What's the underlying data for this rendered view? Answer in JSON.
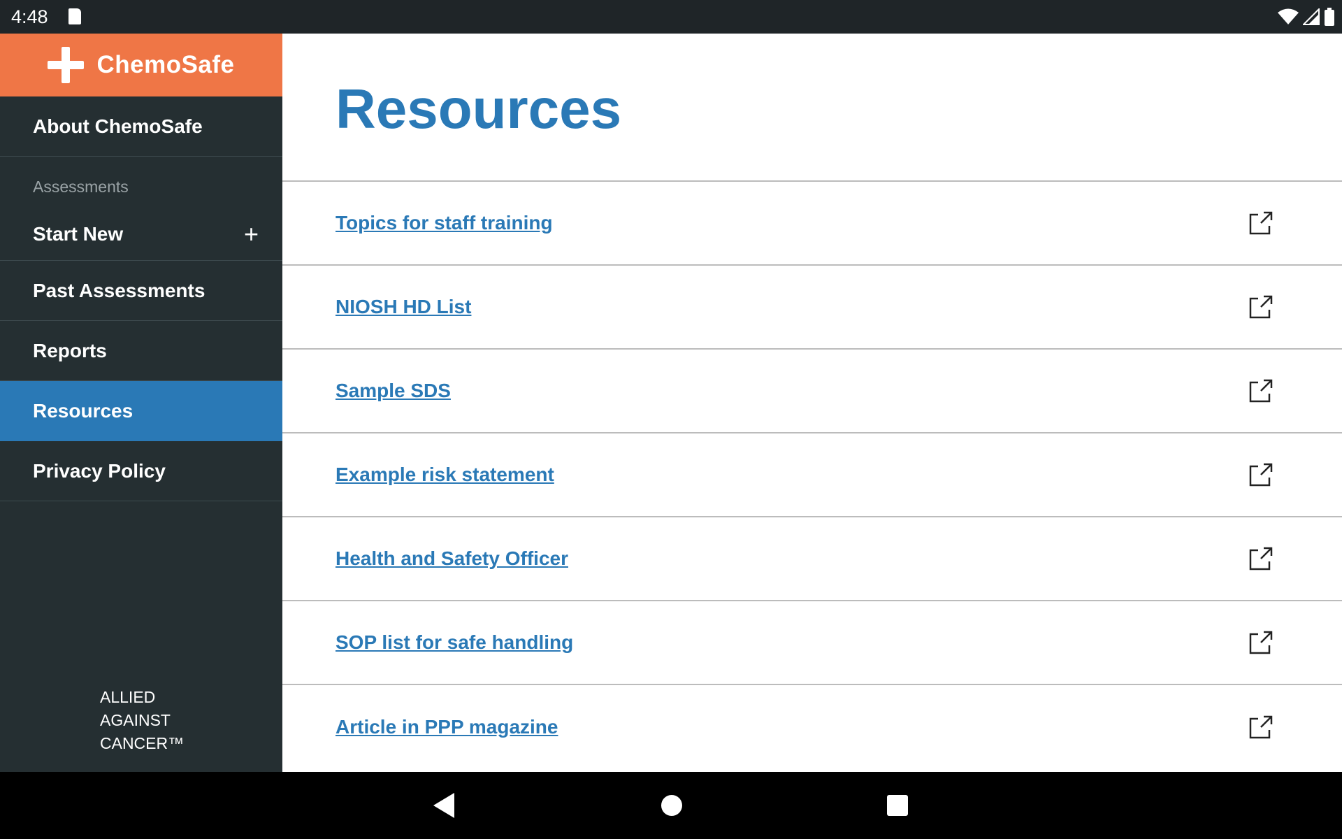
{
  "status_bar": {
    "time": "4:48"
  },
  "sidebar": {
    "brand": "ChemoSafe",
    "about": "About ChemoSafe",
    "section_label": "Assessments",
    "start_new": "Start New",
    "start_new_icon": "plus-icon",
    "past": "Past Assessments",
    "reports": "Reports",
    "resources": "Resources",
    "privacy": "Privacy Policy",
    "footer": [
      "ALLIED",
      "AGAINST",
      "CANCER™"
    ]
  },
  "main": {
    "title": "Resources",
    "items": [
      {
        "label": "Topics for staff training",
        "icon": "external-link-icon"
      },
      {
        "label": "NIOSH HD List",
        "icon": "external-link-icon"
      },
      {
        "label": "Sample SDS",
        "icon": "external-link-icon"
      },
      {
        "label": "Example risk statement",
        "icon": "external-link-icon"
      },
      {
        "label": "Health and Safety Officer",
        "icon": "external-link-icon"
      },
      {
        "label": "SOP list for safe handling",
        "icon": "external-link-icon"
      },
      {
        "label": "Article in PPP magazine",
        "icon": "external-link-icon"
      }
    ]
  },
  "colors": {
    "brand_orange": "#ef7646",
    "sidebar_bg": "#252f32",
    "active_blue": "#2a79b6",
    "link_blue": "#2a79b6"
  }
}
